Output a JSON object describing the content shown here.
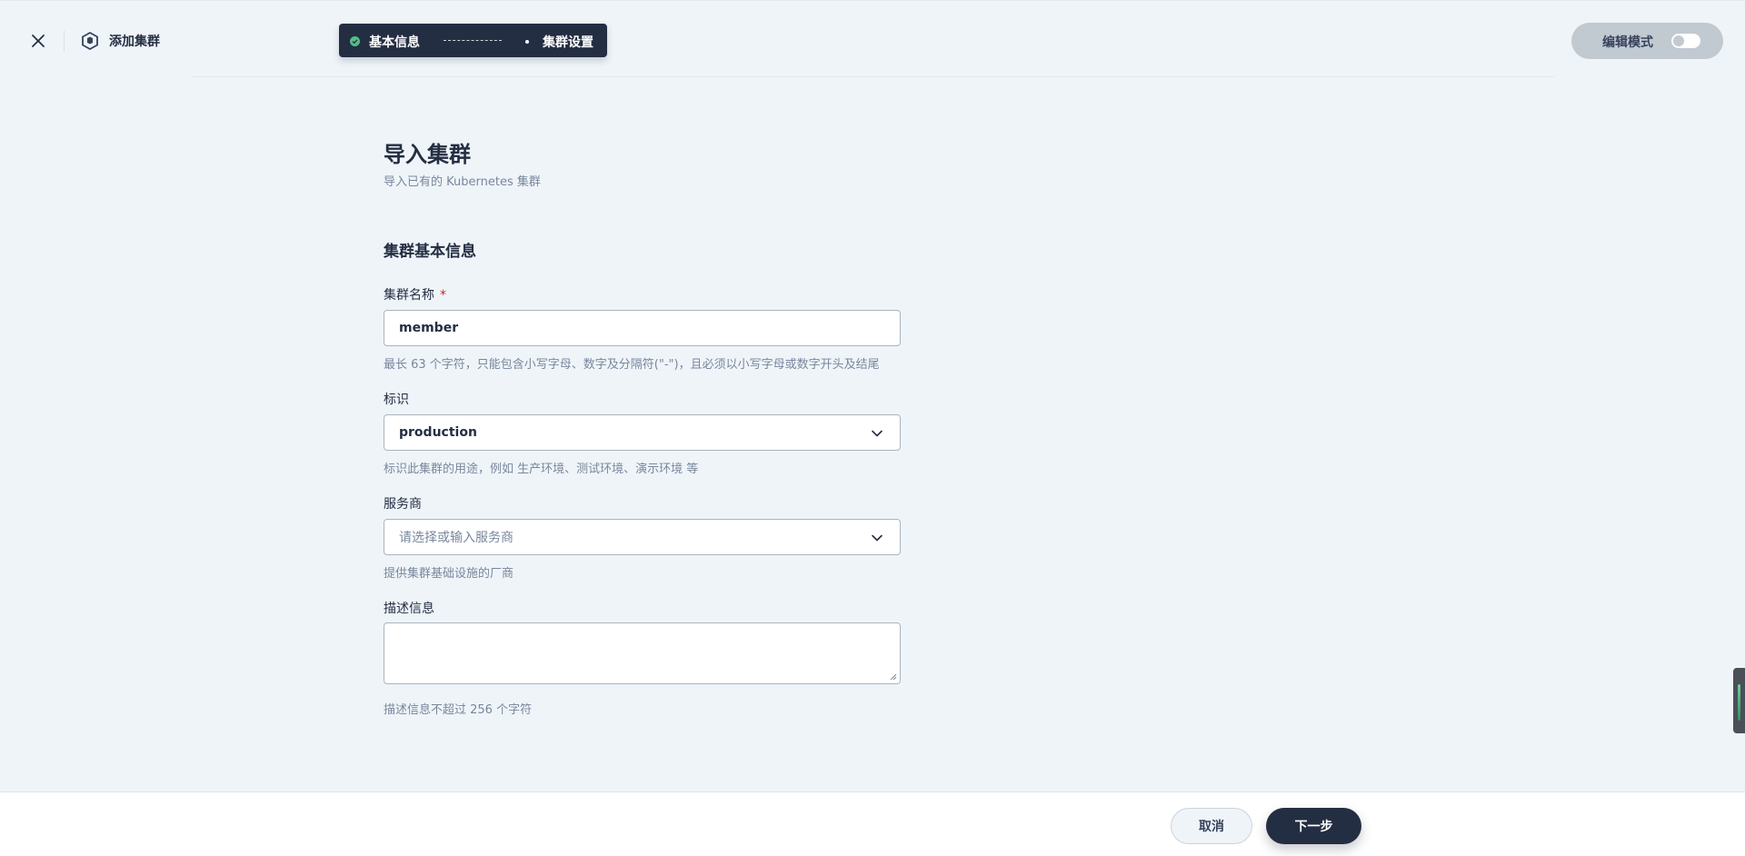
{
  "header": {
    "title": "添加集群",
    "close_icon": "close-icon",
    "cluster_icon": "cluster-icon"
  },
  "stepper": {
    "steps": [
      {
        "label": "基本信息",
        "status": "done"
      },
      {
        "label": "集群设置",
        "status": "current"
      }
    ],
    "done_color": "#55bc8a"
  },
  "edit_mode": {
    "label": "编辑模式",
    "enabled": false
  },
  "page": {
    "title": "导入集群",
    "subtitle": "导入已有的 Kubernetes 集群"
  },
  "form": {
    "section_title": "集群基本信息",
    "name": {
      "label": "集群名称",
      "required_mark": "*",
      "value": "member",
      "hint": "最长 63 个字符，只能包含小写字母、数字及分隔符(\"-\")，且必须以小写字母或数字开头及结尾"
    },
    "tag": {
      "label": "标识",
      "value": "production",
      "hint": "标识此集群的用途，例如 生产环境、测试环境、演示环境 等"
    },
    "provider": {
      "label": "服务商",
      "placeholder": "请选择或输入服务商",
      "hint": "提供集群基础设施的厂商"
    },
    "description": {
      "label": "描述信息",
      "value": "",
      "hint": "描述信息不超过 256 个字符"
    }
  },
  "footer": {
    "cancel_label": "取消",
    "next_label": "下一步"
  },
  "colors": {
    "background": "#eff4f9",
    "primary": "#242e42",
    "success": "#55bc8a",
    "required": "#ca2621"
  }
}
